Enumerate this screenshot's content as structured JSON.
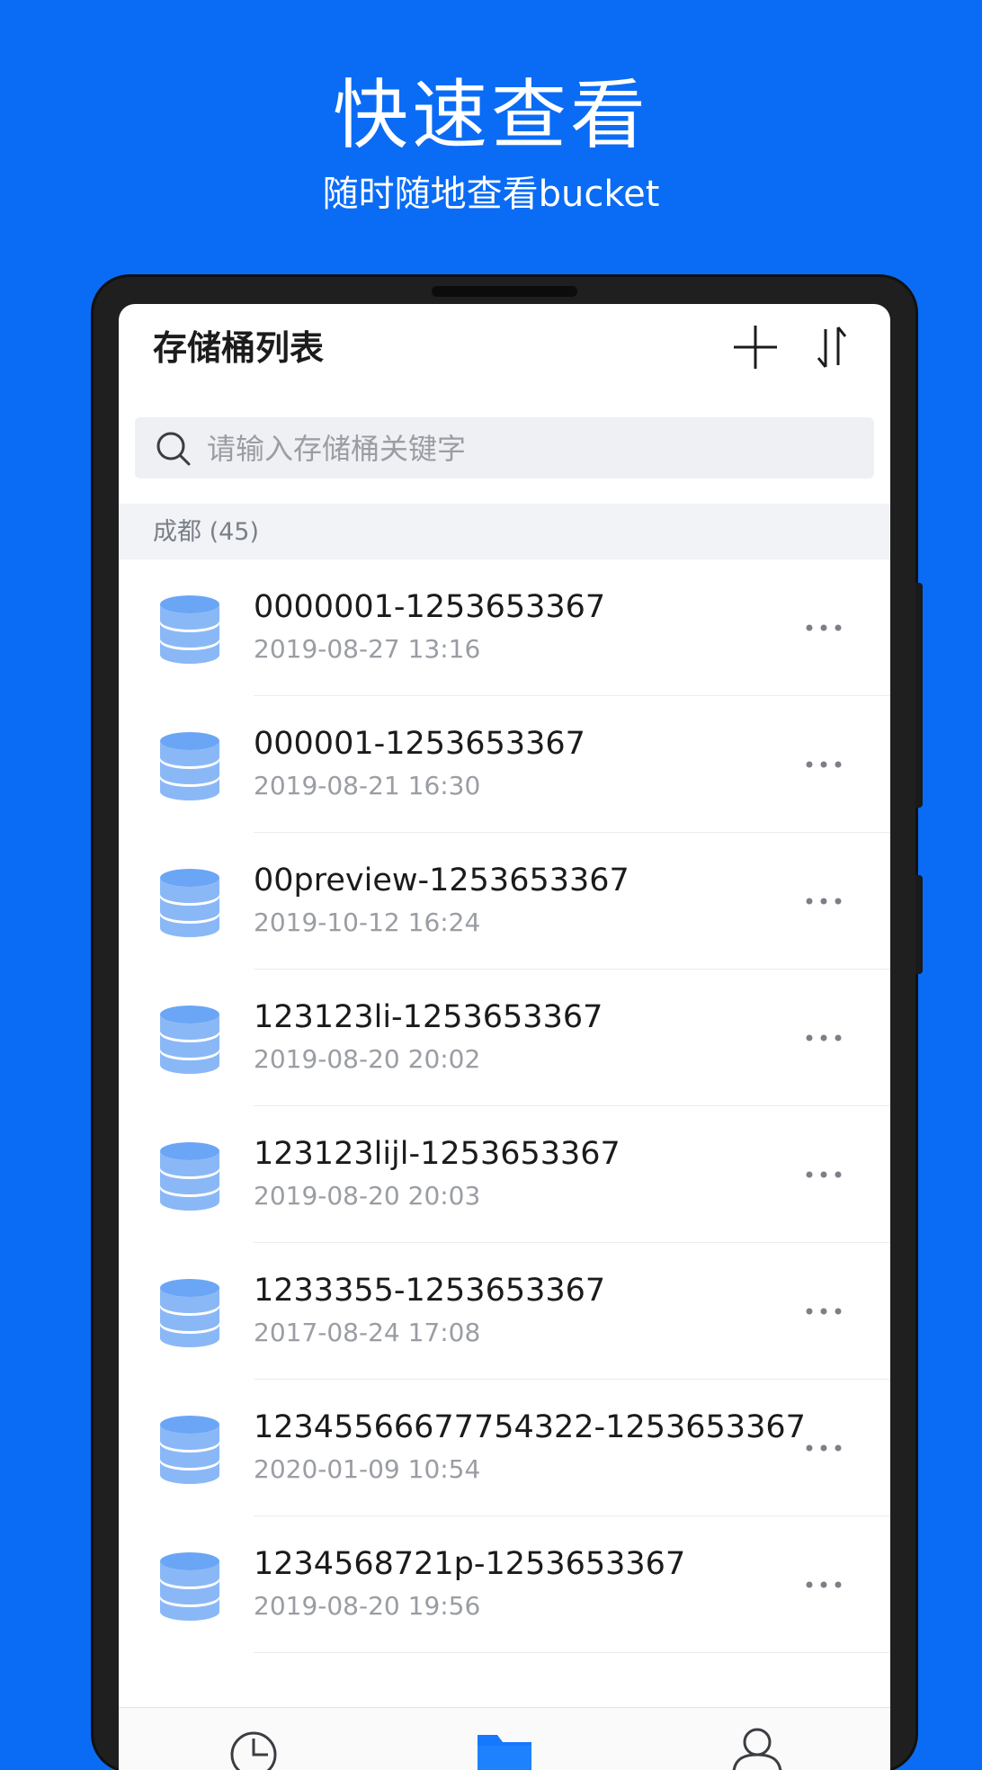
{
  "promo": {
    "title": "快速查看",
    "subtitle": "随时随地查看bucket"
  },
  "header": {
    "title": "存储桶列表",
    "add_icon": "plus-icon",
    "sort_icon": "sort-arrows-icon"
  },
  "search": {
    "placeholder": "请输入存储桶关键字",
    "value": ""
  },
  "section": {
    "label": "成都 (45)"
  },
  "buckets": [
    {
      "name": "0000001-1253653367",
      "date": "2019-08-27 13:16"
    },
    {
      "name": "000001-1253653367",
      "date": "2019-08-21 16:30"
    },
    {
      "name": "00preview-1253653367",
      "date": "2019-10-12 16:24"
    },
    {
      "name": "123123li-1253653367",
      "date": "2019-08-20 20:02"
    },
    {
      "name": "123123lijl-1253653367",
      "date": "2019-08-20 20:03"
    },
    {
      "name": "1233355-1253653367",
      "date": "2017-08-24 17:08"
    },
    {
      "name": "12345566677754322-1253653367",
      "date": "2020-01-09 10:54"
    },
    {
      "name": "1234568721p-1253653367",
      "date": "2019-08-20 19:56"
    }
  ],
  "tabbar": {
    "tabs": [
      {
        "icon": "clock-icon",
        "active": false
      },
      {
        "icon": "folder-icon",
        "active": true
      },
      {
        "icon": "user-icon",
        "active": false
      }
    ]
  },
  "colors": {
    "background": "#0a6cf5",
    "accent": "#1677ff",
    "bucket_icon": "#8ab8f7",
    "muted_text": "#9a9da3"
  }
}
